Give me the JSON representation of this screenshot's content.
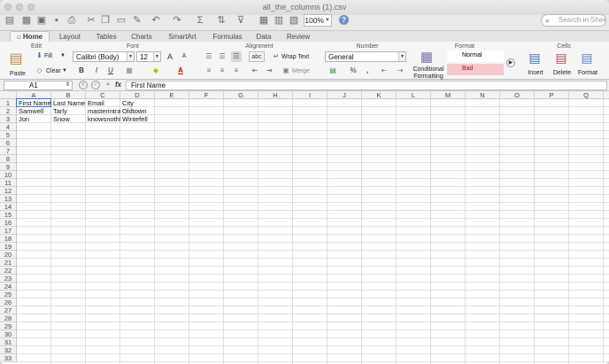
{
  "window": {
    "title": "all_the_columns (1).csv"
  },
  "toolbar": {
    "zoom": "100%",
    "help_label": "?",
    "search_placeholder": "Search in Sheet",
    "icons": [
      "new-workbook-icon",
      "templates-icon",
      "open-icon",
      "save-icon",
      "print-icon",
      "cut-icon",
      "copy-icon",
      "paste-icon",
      "format-painter-icon",
      "undo-icon",
      "redo-icon",
      "autosum-icon",
      "sort-icon",
      "filter-icon",
      "gallery-icon",
      "toolbox-icon",
      "media-icon"
    ]
  },
  "tabs": [
    "Home",
    "Layout",
    "Tables",
    "Charts",
    "SmartArt",
    "Formulas",
    "Data",
    "Review"
  ],
  "active_tab": "Home",
  "ribbon": {
    "groups": [
      "Edit",
      "Font",
      "Alignment",
      "Number",
      "Format",
      "Cells"
    ],
    "edit": {
      "paste": "Paste",
      "fill": "Fill",
      "clear": "Clear"
    },
    "font": {
      "name": "Calibri (Body)",
      "size": "12",
      "bold": "B",
      "italic": "I",
      "underline": "U",
      "grow": "A",
      "shrink": "A"
    },
    "alignment": {
      "abc": "abc",
      "wrap_text": "Wrap Text",
      "merge": "Merge"
    },
    "number": {
      "format": "General",
      "percent": "%",
      "comma": ","
    },
    "format": {
      "conditional": "Conditional Formatting",
      "style_normal": "Normal",
      "style_bad": "Bad"
    },
    "cells": {
      "insert": "Insert",
      "delete": "Delete",
      "format": "Format"
    }
  },
  "formula_bar": {
    "name_box": "A1",
    "fx": "fx",
    "value": "First Name"
  },
  "sheet": {
    "columns": [
      "A",
      "B",
      "C",
      "D",
      "E",
      "F",
      "G",
      "H",
      "I",
      "J",
      "K",
      "L",
      "M",
      "N",
      "O",
      "P",
      "Q"
    ],
    "row_count": 33,
    "cells": [
      [
        "First Name",
        "Last Name",
        "Email",
        "City"
      ],
      [
        "Samwell",
        "Tarly",
        "masterintraining@citadel.com",
        "Oldtown"
      ],
      [
        "Jon",
        "Snow",
        "knowsnothing@nightswatch.org",
        "Wintefell"
      ]
    ]
  },
  "colors": {
    "ribbon_bg": "#f5f5f5",
    "bad_fill": "#f6c8cc",
    "bad_text": "#9c1a26",
    "grid": "#dedede"
  }
}
